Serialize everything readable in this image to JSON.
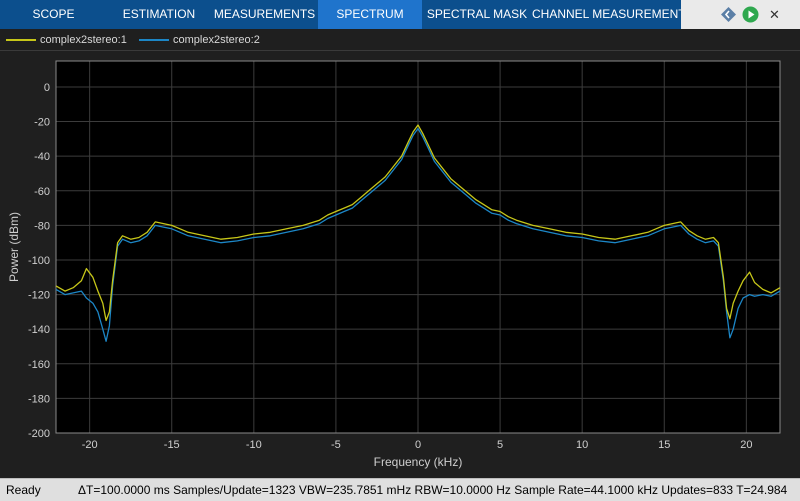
{
  "toolbar": {
    "tabs": [
      "SCOPE",
      "ESTIMATION",
      "MEASUREMENTS",
      "SPECTRUM",
      "SPECTRAL MASK",
      "CHANNEL MEASUREMENTS"
    ],
    "active_tab": "SPECTRUM",
    "controls": [
      "diamond-nav-icon",
      "run-icon",
      "close-icon"
    ]
  },
  "legend": {
    "items": [
      {
        "label": "complex2stereo:1",
        "color": "#c7c719"
      },
      {
        "label": "complex2stereo:2",
        "color": "#1c86c6"
      }
    ]
  },
  "status": {
    "ready": "Ready",
    "details": "ΔT=100.0000 ms  Samples/Update=1323  VBW=235.7851 mHz  RBW=10.0000 Hz  Sample Rate=44.1000 kHz  Updates=833  T=24.984"
  },
  "chart_data": {
    "type": "line",
    "title": "",
    "xlabel": "Frequency (kHz)",
    "ylabel": "Power (dBm)",
    "xlim": [
      -22.05,
      22.05
    ],
    "ylim": [
      -200,
      15
    ],
    "xticks": [
      -20,
      -15,
      -10,
      -5,
      0,
      5,
      10,
      15,
      20
    ],
    "yticks": [
      0,
      -20,
      -40,
      -60,
      -80,
      -100,
      -120,
      -140,
      -160,
      -180,
      -200
    ],
    "grid": true,
    "legend_position": "top-left",
    "series": [
      {
        "name": "complex2stereo:1",
        "color": "#c7c719",
        "x": [
          -22.05,
          -21.5,
          -21,
          -20.5,
          -20.2,
          -19.8,
          -19.5,
          -19.2,
          -19.0,
          -18.8,
          -18.6,
          -18.3,
          -18.0,
          -17.5,
          -17,
          -16.5,
          -16,
          -15.5,
          -15,
          -14.5,
          -14,
          -13,
          -12,
          -11,
          -10,
          -9,
          -8,
          -7,
          -6,
          -5.5,
          -5,
          -4.5,
          -4,
          -3.5,
          -3,
          -2.5,
          -2,
          -1.5,
          -1,
          -0.6,
          -0.3,
          0,
          0.3,
          0.6,
          1,
          1.5,
          2,
          2.5,
          3,
          3.5,
          4,
          4.5,
          5,
          5.5,
          6,
          7,
          8,
          9,
          10,
          11,
          12,
          13,
          14,
          14.5,
          15,
          15.5,
          16,
          16.5,
          17,
          17.5,
          18,
          18.3,
          18.6,
          18.8,
          19.0,
          19.2,
          19.5,
          19.8,
          20.2,
          20.5,
          21,
          21.5,
          22.05
        ],
        "y": [
          -115,
          -118,
          -116,
          -112,
          -105,
          -110,
          -118,
          -125,
          -135,
          -130,
          -112,
          -90,
          -86,
          -88,
          -87,
          -84,
          -78,
          -79,
          -80,
          -82,
          -84,
          -86,
          -88,
          -87,
          -85,
          -84,
          -82,
          -80,
          -77,
          -74,
          -72,
          -70,
          -68,
          -64,
          -60,
          -56,
          -52,
          -46,
          -40,
          -32,
          -26,
          -22,
          -27,
          -33,
          -41,
          -47,
          -53,
          -57,
          -61,
          -65,
          -68,
          -71,
          -72,
          -75,
          -77,
          -80,
          -82,
          -84,
          -85,
          -87,
          -88,
          -86,
          -84,
          -82,
          -80,
          -79,
          -78,
          -83,
          -86,
          -88,
          -87,
          -90,
          -110,
          -128,
          -134,
          -125,
          -118,
          -112,
          -107,
          -113,
          -117,
          -119,
          -116
        ]
      },
      {
        "name": "complex2stereo:2",
        "color": "#1c86c6",
        "x": [
          -22.05,
          -21.5,
          -21,
          -20.5,
          -20.2,
          -19.8,
          -19.5,
          -19.2,
          -19.0,
          -18.8,
          -18.6,
          -18.3,
          -18.0,
          -17.5,
          -17,
          -16.5,
          -16,
          -15.5,
          -15,
          -14.5,
          -14,
          -13,
          -12,
          -11,
          -10,
          -9,
          -8,
          -7,
          -6,
          -5.5,
          -5,
          -4.5,
          -4,
          -3.5,
          -3,
          -2.5,
          -2,
          -1.5,
          -1,
          -0.6,
          -0.3,
          0,
          0.3,
          0.6,
          1,
          1.5,
          2,
          2.5,
          3,
          3.5,
          4,
          4.5,
          5,
          5.5,
          6,
          7,
          8,
          9,
          10,
          11,
          12,
          13,
          14,
          14.5,
          15,
          15.5,
          16,
          16.5,
          17,
          17.5,
          18,
          18.3,
          18.6,
          18.8,
          19.0,
          19.2,
          19.5,
          19.8,
          20.2,
          20.5,
          21,
          21.5,
          22.05
        ],
        "y": [
          -117,
          -120,
          -119,
          -118,
          -122,
          -125,
          -130,
          -140,
          -147,
          -138,
          -115,
          -92,
          -88,
          -90,
          -89,
          -86,
          -80,
          -81,
          -82,
          -84,
          -86,
          -88,
          -90,
          -89,
          -87,
          -86,
          -84,
          -82,
          -79,
          -76,
          -74,
          -72,
          -70,
          -66,
          -62,
          -58,
          -54,
          -48,
          -42,
          -34,
          -28,
          -24,
          -29,
          -35,
          -43,
          -49,
          -55,
          -59,
          -63,
          -67,
          -70,
          -73,
          -74,
          -77,
          -79,
          -82,
          -84,
          -86,
          -87,
          -89,
          -90,
          -88,
          -86,
          -84,
          -82,
          -81,
          -80,
          -85,
          -88,
          -90,
          -89,
          -92,
          -112,
          -130,
          -145,
          -140,
          -128,
          -122,
          -120,
          -121,
          -120,
          -121,
          -118
        ]
      }
    ]
  }
}
